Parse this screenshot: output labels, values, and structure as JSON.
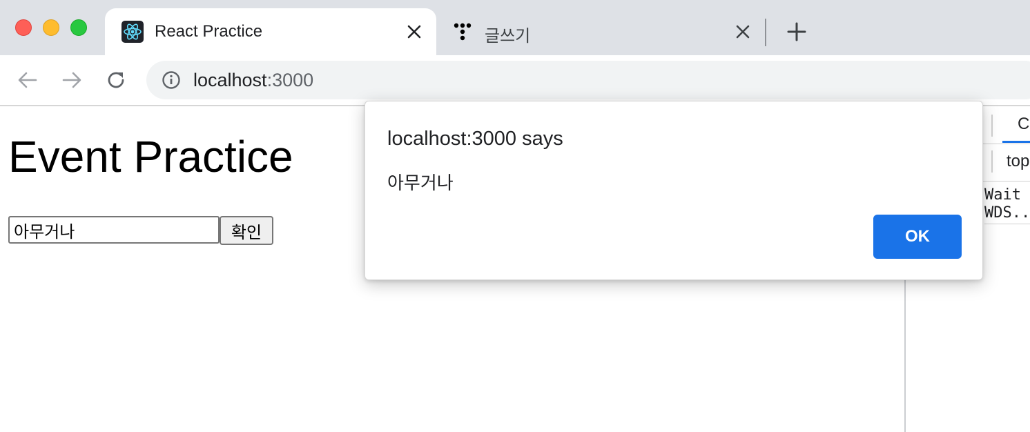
{
  "window": {
    "controls": [
      "close",
      "minimize",
      "zoom"
    ]
  },
  "tabs": [
    {
      "title": "React Practice",
      "icon": "react-logo-icon",
      "active": true
    },
    {
      "title": "글쓰기",
      "icon": "tistory-logo-icon",
      "active": false
    }
  ],
  "toolbar": {
    "url_host": "localhost",
    "url_port": ":3000"
  },
  "page": {
    "heading": "Event Practice",
    "input_value": "아무거나",
    "button_label": "확인"
  },
  "devtools": {
    "tab_partial": "Co",
    "context_partial": "top",
    "console_text": "Wait\nWDS.."
  },
  "dialog": {
    "title": "localhost:3000 says",
    "message": "아무거나",
    "ok_label": "OK"
  },
  "colors": {
    "tabstrip": "#dee1e6",
    "ok_button": "#1a73e8",
    "omnibox": "#f1f3f4"
  }
}
